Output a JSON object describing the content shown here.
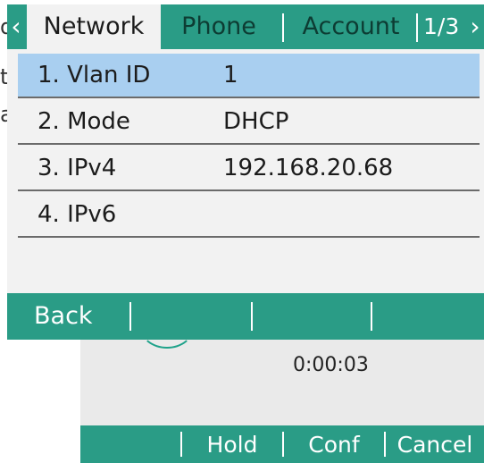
{
  "background_fragments": {
    "line1": "d",
    "line2": "t",
    "line3": "a"
  },
  "menu": {
    "tabs": {
      "network": "Network",
      "phone": "Phone",
      "account": "Account"
    },
    "page_indicator": "1/3",
    "prev_arrow": "‹",
    "next_arrow": "›",
    "items": [
      {
        "label": "1. Vlan ID",
        "value": "1",
        "selected": true
      },
      {
        "label": "2. Mode",
        "value": "DHCP",
        "selected": false
      },
      {
        "label": "3. IPv4",
        "value": "192.168.20.68",
        "selected": false
      },
      {
        "label": "4. IPv6",
        "value": "",
        "selected": false
      }
    ],
    "softkeys": {
      "back": "Back",
      "key2": "",
      "key3": "",
      "key4": ""
    }
  },
  "call": {
    "timer": "0:00:03",
    "softkeys": {
      "key1": "",
      "hold": "Hold",
      "conf": "Conf",
      "cancel": "Cancel"
    }
  },
  "colors": {
    "accent": "#2a9c86",
    "selected_row": "#a9cff0",
    "menu_background": "#f2f2f2",
    "call_background": "#eaeaea"
  }
}
